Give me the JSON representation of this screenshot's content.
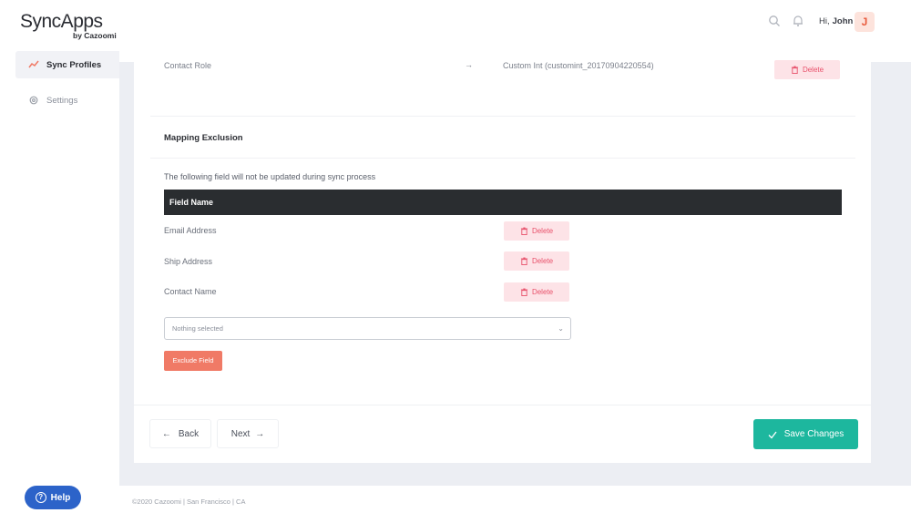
{
  "header": {
    "logo_brand": "SyncApps",
    "logo_sub": "by Cazoomi",
    "greeting": "Hi,",
    "user_name": "John",
    "avatar_initial": "J",
    "icons": [
      "search-icon",
      "bell-icon"
    ]
  },
  "sidebar": {
    "items": [
      {
        "label": "Sync Profiles",
        "icon": "trend-icon",
        "active": true
      },
      {
        "label": "Settings",
        "icon": "gear-icon",
        "active": false
      }
    ],
    "help_label": "Help"
  },
  "mapping_row": {
    "source": "Contact Role",
    "arrow": "→",
    "target": "Custom Int (customint_20170904220554)",
    "delete_label": "Delete"
  },
  "exclusion": {
    "title": "Mapping Exclusion",
    "description": "The following field will not be updated during sync process",
    "column_header": "Field Name",
    "rows": [
      {
        "field": "Email Address",
        "delete_label": "Delete"
      },
      {
        "field": "Ship Address",
        "delete_label": "Delete"
      },
      {
        "field": "Contact Name",
        "delete_label": "Delete"
      }
    ],
    "select_placeholder": "Nothing selected",
    "exclude_button": "Exclude Field"
  },
  "actions": {
    "back_label": "Back",
    "next_label": "Next",
    "save_label": "Save Changes"
  },
  "footer": {
    "text": "©2020 Cazoomi | San Francisco | CA"
  },
  "colors": {
    "accent_teal": "#1db79e",
    "danger_pink": "#e8506a",
    "exclude_orange": "#f07a66",
    "help_blue": "#2c63c9",
    "table_header": "#2a2d30"
  }
}
